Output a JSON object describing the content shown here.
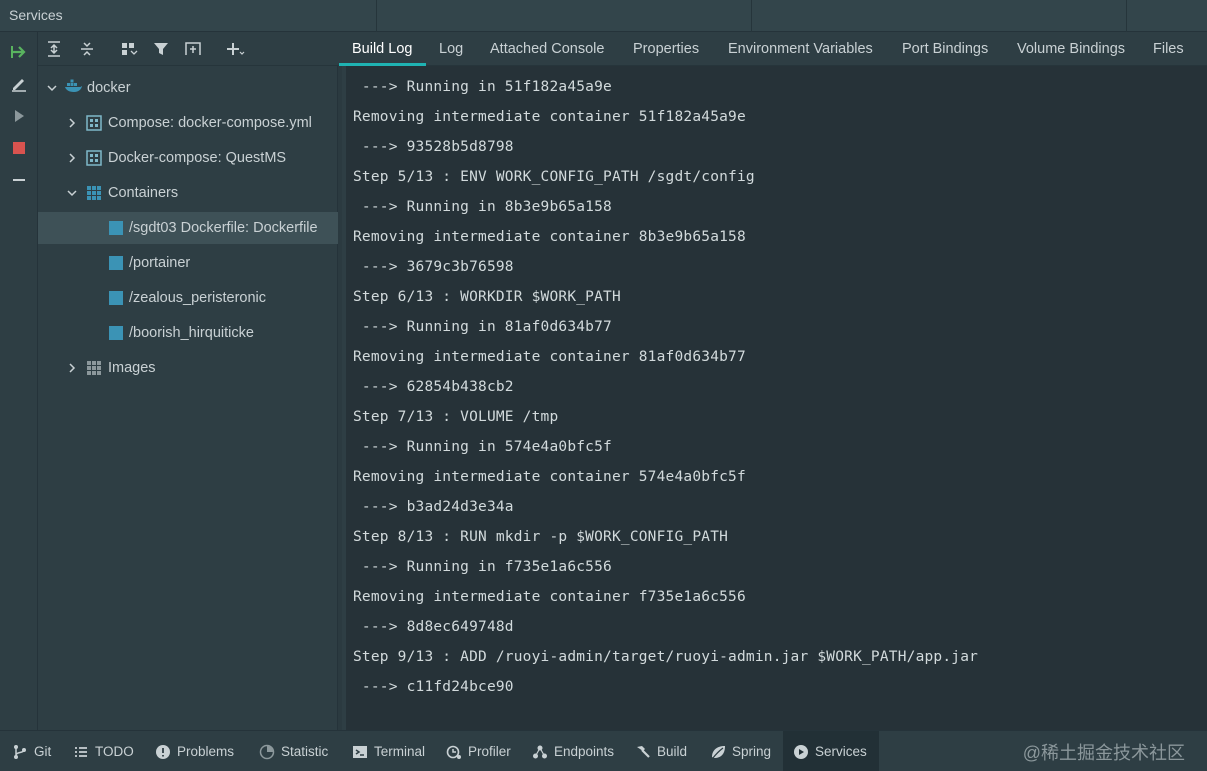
{
  "window": {
    "title": "Services"
  },
  "colors": {
    "accent": "#1fb3b3",
    "stop_red": "#d9534f",
    "run_green": "#59b35f",
    "container_blue": "#3b93b5"
  },
  "strip": {
    "icons": [
      "run-arrow-icon",
      "edit-icon",
      "play-icon",
      "stop-icon",
      "minus-icon"
    ]
  },
  "tree_toolbar": {
    "icons": [
      "expand-all-icon",
      "collapse-all-icon",
      "group-icon",
      "filter-icon",
      "new-tab-icon",
      "add-icon"
    ]
  },
  "tree": {
    "root": {
      "label": "docker",
      "icon": "docker-whale-icon"
    },
    "items": [
      {
        "label": "Compose: docker-compose.yml",
        "icon": "compose-icon"
      },
      {
        "label": "Docker-compose: QuestMS",
        "icon": "compose-icon"
      },
      {
        "label": "Containers",
        "icon": "containers-grid-icon"
      },
      {
        "label": "/sgdt03 Dockerfile: Dockerfile",
        "icon": "container-icon"
      },
      {
        "label": "/portainer",
        "icon": "container-icon"
      },
      {
        "label": "/zealous_peristeronic",
        "icon": "container-icon"
      },
      {
        "label": "/boorish_hirquiticke",
        "icon": "container-icon"
      },
      {
        "label": "Images",
        "icon": "images-grid-icon"
      }
    ]
  },
  "tabs": [
    {
      "label": "Build Log"
    },
    {
      "label": "Log"
    },
    {
      "label": "Attached Console"
    },
    {
      "label": "Properties"
    },
    {
      "label": "Environment Variables"
    },
    {
      "label": "Port Bindings"
    },
    {
      "label": "Volume Bindings"
    },
    {
      "label": "Files"
    }
  ],
  "log": {
    "lines": [
      " ---> Running in 51f182a45a9e",
      "Removing intermediate container 51f182a45a9e",
      " ---> 93528b5d8798",
      "Step 5/13 : ENV WORK_CONFIG_PATH /sgdt/config",
      " ---> Running in 8b3e9b65a158",
      "Removing intermediate container 8b3e9b65a158",
      " ---> 3679c3b76598",
      "Step 6/13 : WORKDIR $WORK_PATH",
      " ---> Running in 81af0d634b77",
      "Removing intermediate container 81af0d634b77",
      " ---> 62854b438cb2",
      "Step 7/13 : VOLUME /tmp",
      " ---> Running in 574e4a0bfc5f",
      "Removing intermediate container 574e4a0bfc5f",
      " ---> b3ad24d3e34a",
      "Step 8/13 : RUN mkdir -p $WORK_CONFIG_PATH",
      " ---> Running in f735e1a6c556",
      "Removing intermediate container f735e1a6c556",
      " ---> 8d8ec649748d",
      "Step 9/13 : ADD /ruoyi-admin/target/ruoyi-admin.jar $WORK_PATH/app.jar",
      " ---> c11fd24bce90"
    ]
  },
  "bottom_bar": {
    "items": [
      {
        "label": "Git",
        "icon": "git-branch-icon"
      },
      {
        "label": "TODO",
        "icon": "todo-list-icon"
      },
      {
        "label": "Problems",
        "icon": "problems-icon"
      },
      {
        "label": "Statistic",
        "icon": "statistic-icon"
      },
      {
        "label": "Terminal",
        "icon": "terminal-icon"
      },
      {
        "label": "Profiler",
        "icon": "profiler-icon"
      },
      {
        "label": "Endpoints",
        "icon": "endpoints-icon"
      },
      {
        "label": "Build",
        "icon": "hammer-icon"
      },
      {
        "label": "Spring",
        "icon": "spring-leaf-icon"
      },
      {
        "label": "Services",
        "icon": "services-play-icon"
      }
    ],
    "watermark": "@稀土掘金技术社区"
  }
}
